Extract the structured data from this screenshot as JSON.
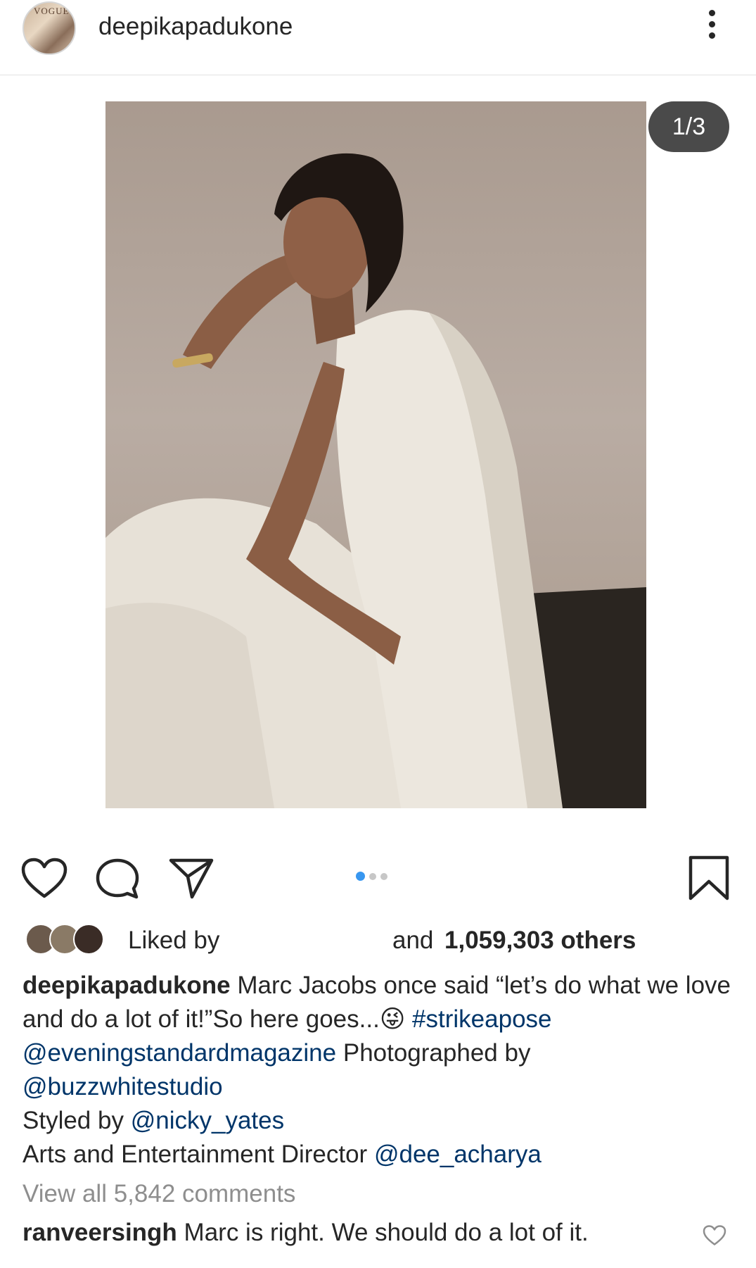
{
  "header": {
    "username": "deepikapadukone",
    "avatar_text": "VOGUE"
  },
  "post": {
    "counter": "1/3",
    "carousel": {
      "total": 3,
      "active_index": 0
    },
    "likes": {
      "prefix": "Liked by",
      "suffix_and": "and",
      "count_text": "1,059,303 others"
    },
    "caption": {
      "username": "deepikapadukone",
      "line1_text": "Marc Jacobs once said “let’s do what we love and do a lot of it!”So here goes...😜",
      "hashtag": "#strikeapose",
      "mention_magazine": "@eveningstandardmagazine",
      "photographed_by": "Photographed by",
      "mention_studio": "@buzzwhitestudio",
      "styled_by": "Styled by",
      "mention_stylist": "@nicky_yates",
      "director_label": "Arts and Entertainment Director",
      "mention_director": "@dee_acharya"
    },
    "view_all_comments": "View all 5,842 comments",
    "top_comment": {
      "username": "ranveersingh",
      "text": "Marc is right. We should do a lot of it."
    }
  },
  "icons": {
    "more": "more-vertical-icon",
    "like": "heart-icon",
    "comment": "comment-icon",
    "share": "paper-plane-icon",
    "save": "bookmark-icon"
  },
  "colors": {
    "text": "#262626",
    "link": "#003569",
    "muted": "#8e8e8e",
    "carousel_active": "#3897f0",
    "counter_bg": "#4a4a4a"
  }
}
